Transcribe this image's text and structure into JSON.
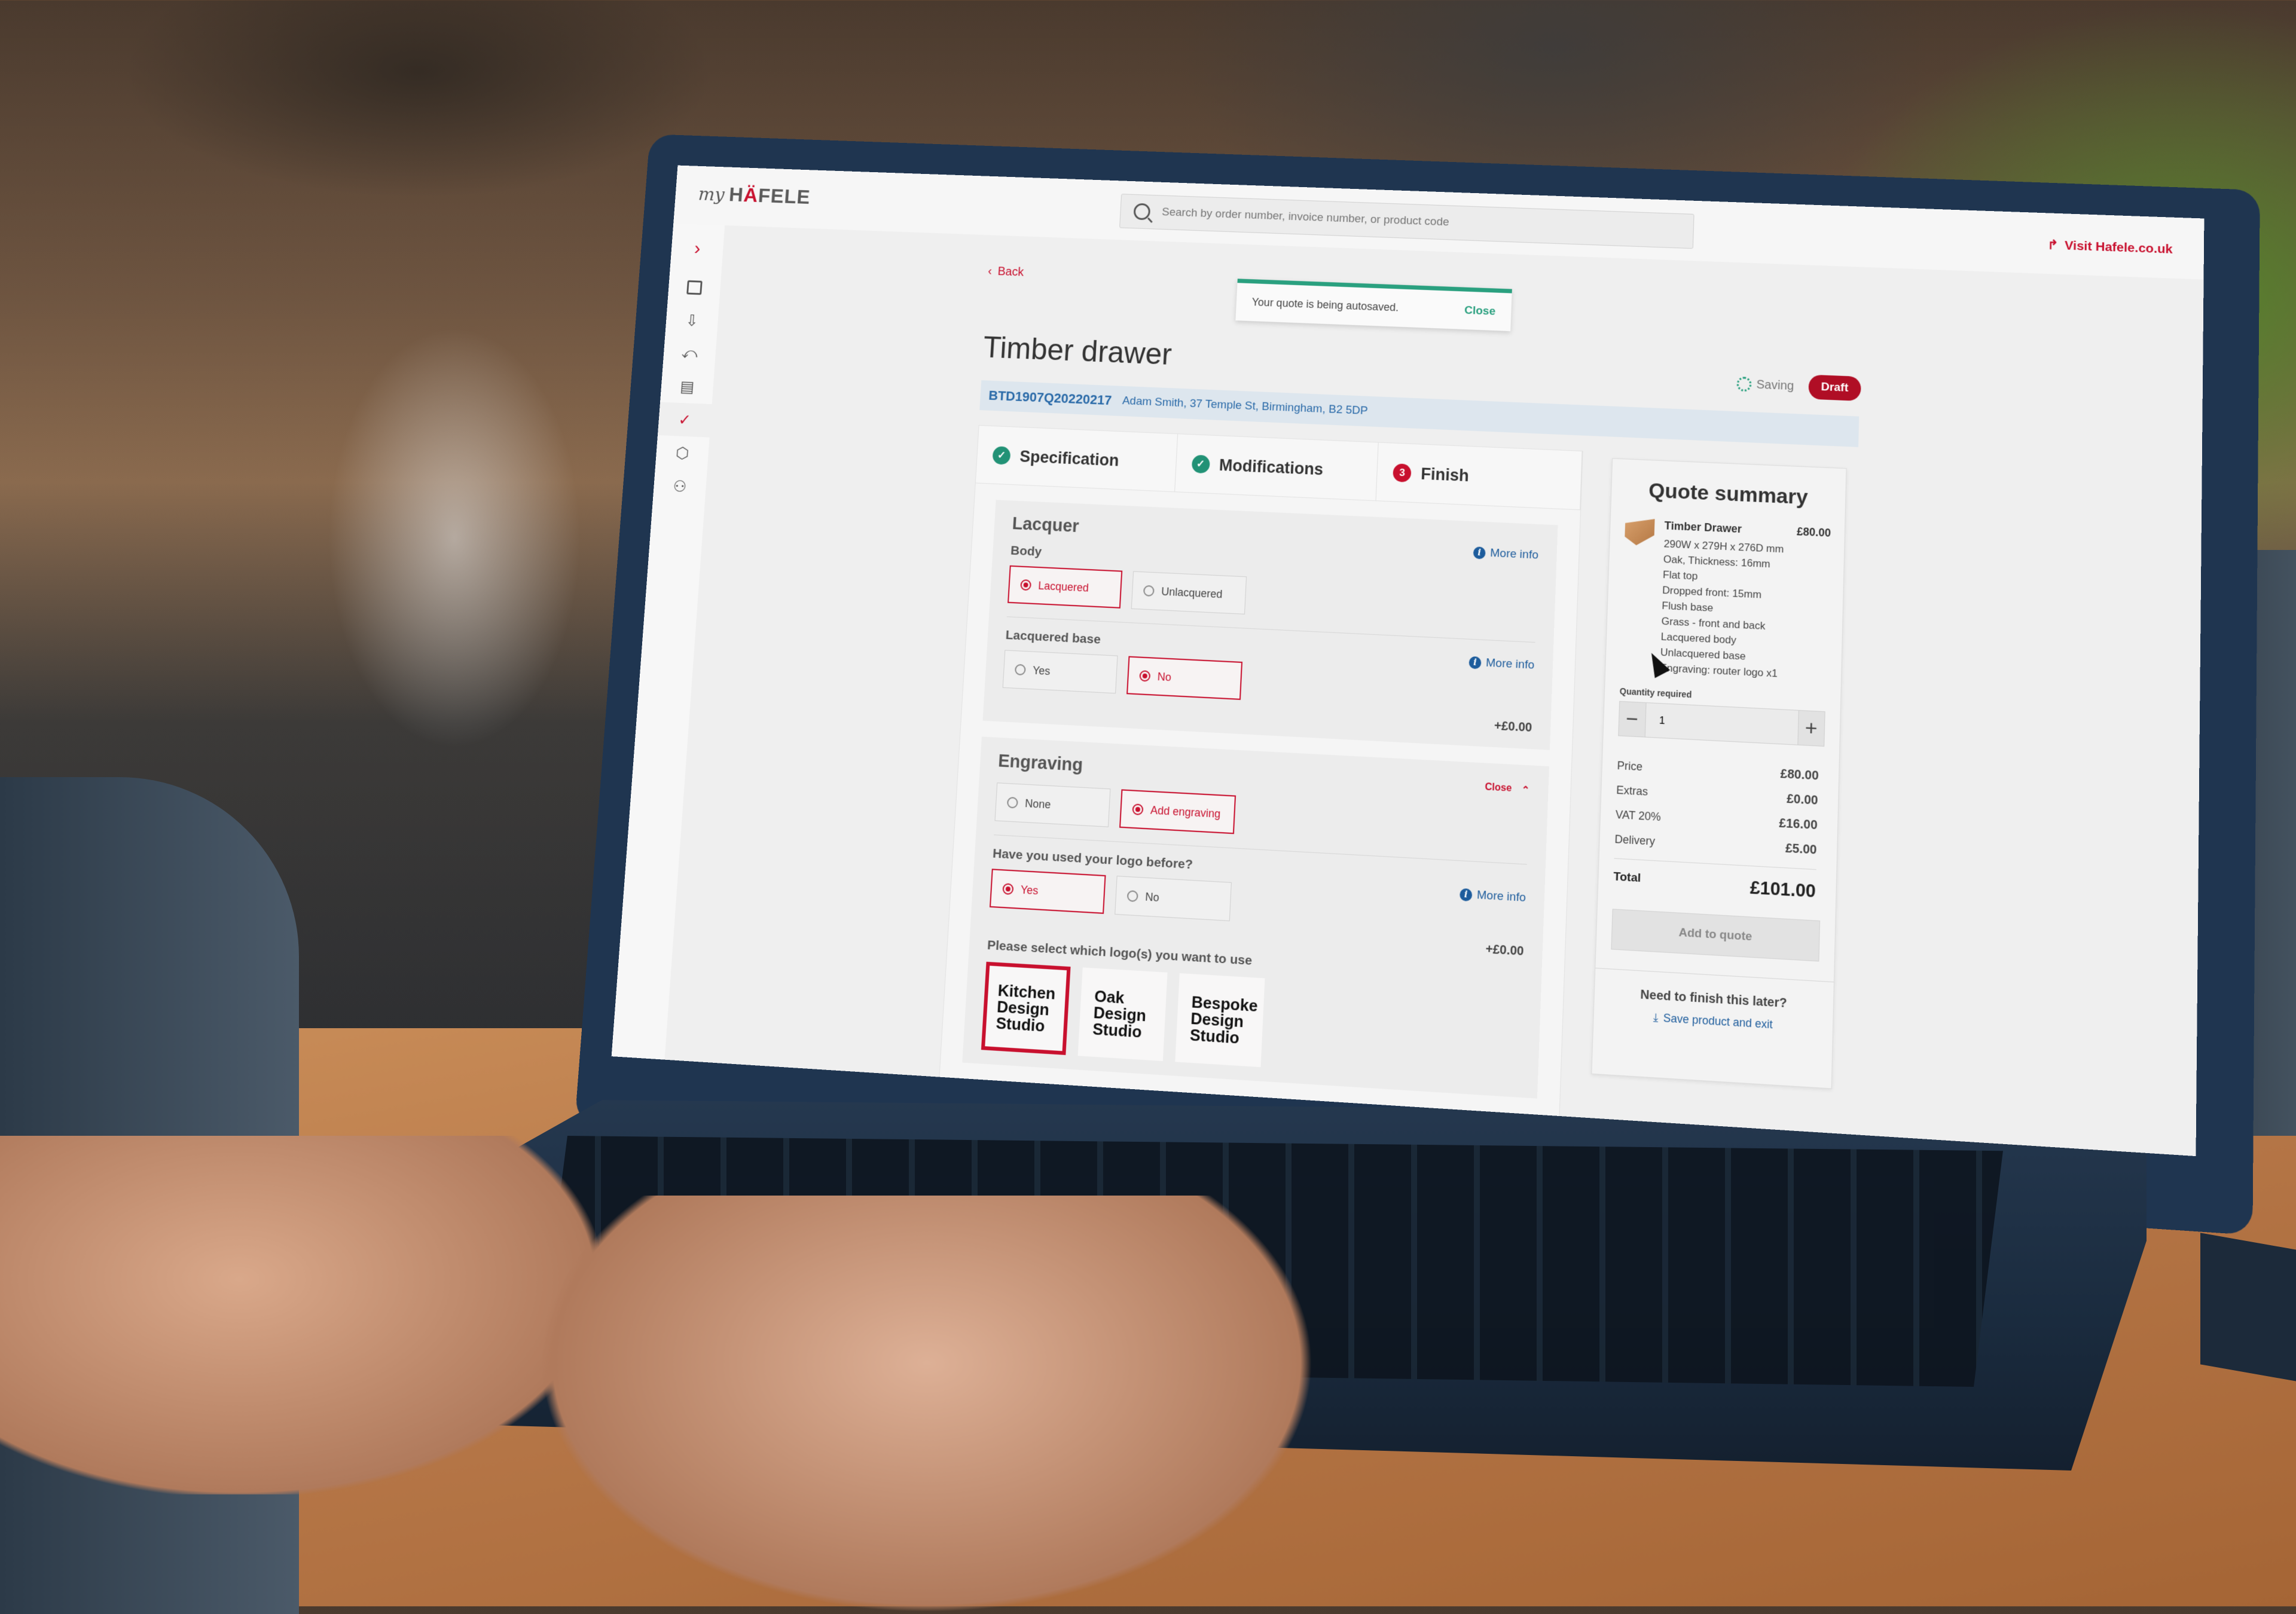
{
  "app": {
    "logo_prefix": "my",
    "logo_brand_1": "H",
    "logo_brand_accent": "Ä",
    "logo_brand_2": "FELE",
    "visit_link": "Visit Hafele.co.uk",
    "accent_color": "#c8102e",
    "success_color": "#2aa07f",
    "link_color": "#1d5c9c"
  },
  "search": {
    "placeholder": "Search by order number, invoice number, or product code",
    "value": ""
  },
  "sidebar": {
    "expand_icon": "chevron-right-icon",
    "items": [
      {
        "icon": "stack-icon",
        "active": false
      },
      {
        "icon": "inbox-download-icon",
        "active": false
      },
      {
        "icon": "inbox-return-icon",
        "active": false
      },
      {
        "icon": "document-icon",
        "active": false
      },
      {
        "icon": "document-check-icon",
        "active": true
      },
      {
        "icon": "package-icon",
        "active": false
      },
      {
        "icon": "user-icon",
        "active": false
      }
    ]
  },
  "page": {
    "back_label": "Back",
    "title": "Timber drawer",
    "reference": "BTD1907Q20220217",
    "customer_address": "Adam Smith, 37 Temple St, Birmingham, B2 5DP",
    "saving_label": "Saving",
    "status_badge": "Draft"
  },
  "toast": {
    "message": "Your quote is being autosaved.",
    "close_label": "Close"
  },
  "steps": [
    {
      "label": "Specification",
      "state": "done",
      "marker": "✓"
    },
    {
      "label": "Modifications",
      "state": "done",
      "marker": "✓"
    },
    {
      "label": "Finish",
      "state": "current",
      "marker": "3"
    }
  ],
  "lacquer": {
    "title": "Lacquer",
    "more_info": "More info",
    "body_label": "Body",
    "body_options": [
      {
        "label": "Lacquered",
        "selected": true
      },
      {
        "label": "Unlacquered",
        "selected": false
      }
    ],
    "base_label": "Lacquered base",
    "base_options": [
      {
        "label": "Yes",
        "selected": false
      },
      {
        "label": "No",
        "selected": true
      }
    ],
    "extra_price": "+£0.00"
  },
  "engraving": {
    "title": "Engraving",
    "close_label": "Close",
    "options": [
      {
        "label": "None",
        "selected": false
      },
      {
        "label": "Add engraving",
        "selected": true
      }
    ],
    "logo_question": "Have you used your logo before?",
    "more_info": "More info",
    "logo_options": [
      {
        "label": "Yes",
        "selected": true
      },
      {
        "label": "No",
        "selected": false
      }
    ],
    "extra_price": "+£0.00",
    "select_logo_label": "Please select which logo(s) you want to use",
    "logos": [
      {
        "line1": "Kitchen",
        "line2": "Design",
        "line3": "Studio",
        "selected": true
      },
      {
        "line1": "Oak",
        "line2": "Design",
        "line3": "Studio",
        "selected": false
      },
      {
        "line1": "Bespoke",
        "line2": "Design",
        "line3": "Studio",
        "selected": false
      }
    ]
  },
  "summary": {
    "title": "Quote summary",
    "product_name": "Timber Drawer",
    "product_price": "£80.00",
    "details": [
      "290W x 279H x 276D mm",
      "Oak, Thickness: 16mm",
      "Flat top",
      "Dropped front: 15mm",
      "Flush base",
      "Grass - front and back",
      "Lacquered body",
      "Unlacquered base",
      "Engraving: router logo x1"
    ],
    "quantity_label": "Quantity required",
    "quantity": "1",
    "lines": [
      {
        "label": "Price",
        "value": "£80.00"
      },
      {
        "label": "Extras",
        "value": "£0.00"
      },
      {
        "label": "VAT 20%",
        "value": "£16.00"
      },
      {
        "label": "Delivery",
        "value": "£5.00"
      }
    ],
    "total_label": "Total",
    "total_value": "£101.00",
    "add_button": "Add to quote",
    "later_question": "Need to finish this later?",
    "save_exit": "Save product and exit"
  }
}
